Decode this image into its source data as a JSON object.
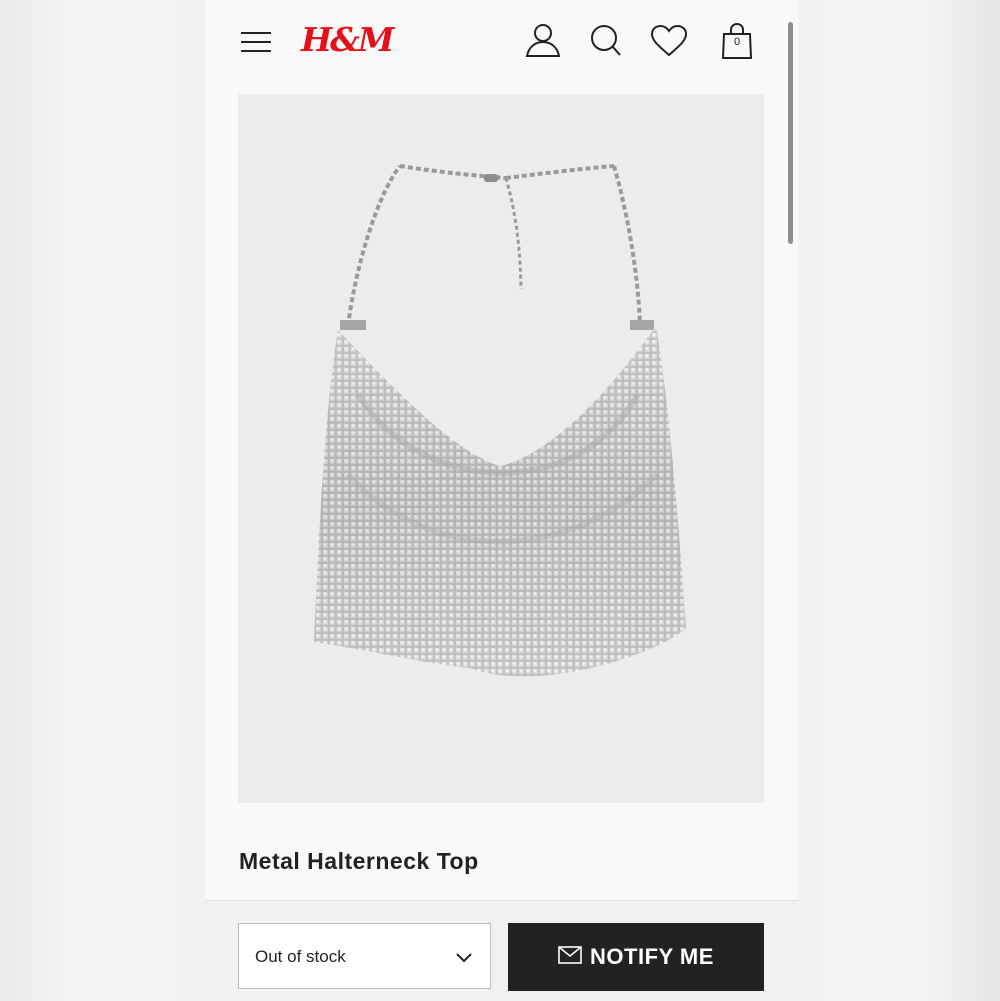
{
  "header": {
    "brand": "H&M",
    "cart_count": "0",
    "icons": [
      "menu-icon",
      "account-icon",
      "search-icon",
      "favorites-icon",
      "shopping-bag-icon"
    ]
  },
  "product": {
    "title": "Metal Halterneck Top",
    "image": "metal-halterneck-top-image"
  },
  "purchase": {
    "size_select_value": "Out of stock",
    "notify_button_label": "NOTIFY ME"
  },
  "colors": {
    "brand_red": "#e3101b",
    "button_dark": "#222222",
    "page_bg": "#faf9f8"
  }
}
